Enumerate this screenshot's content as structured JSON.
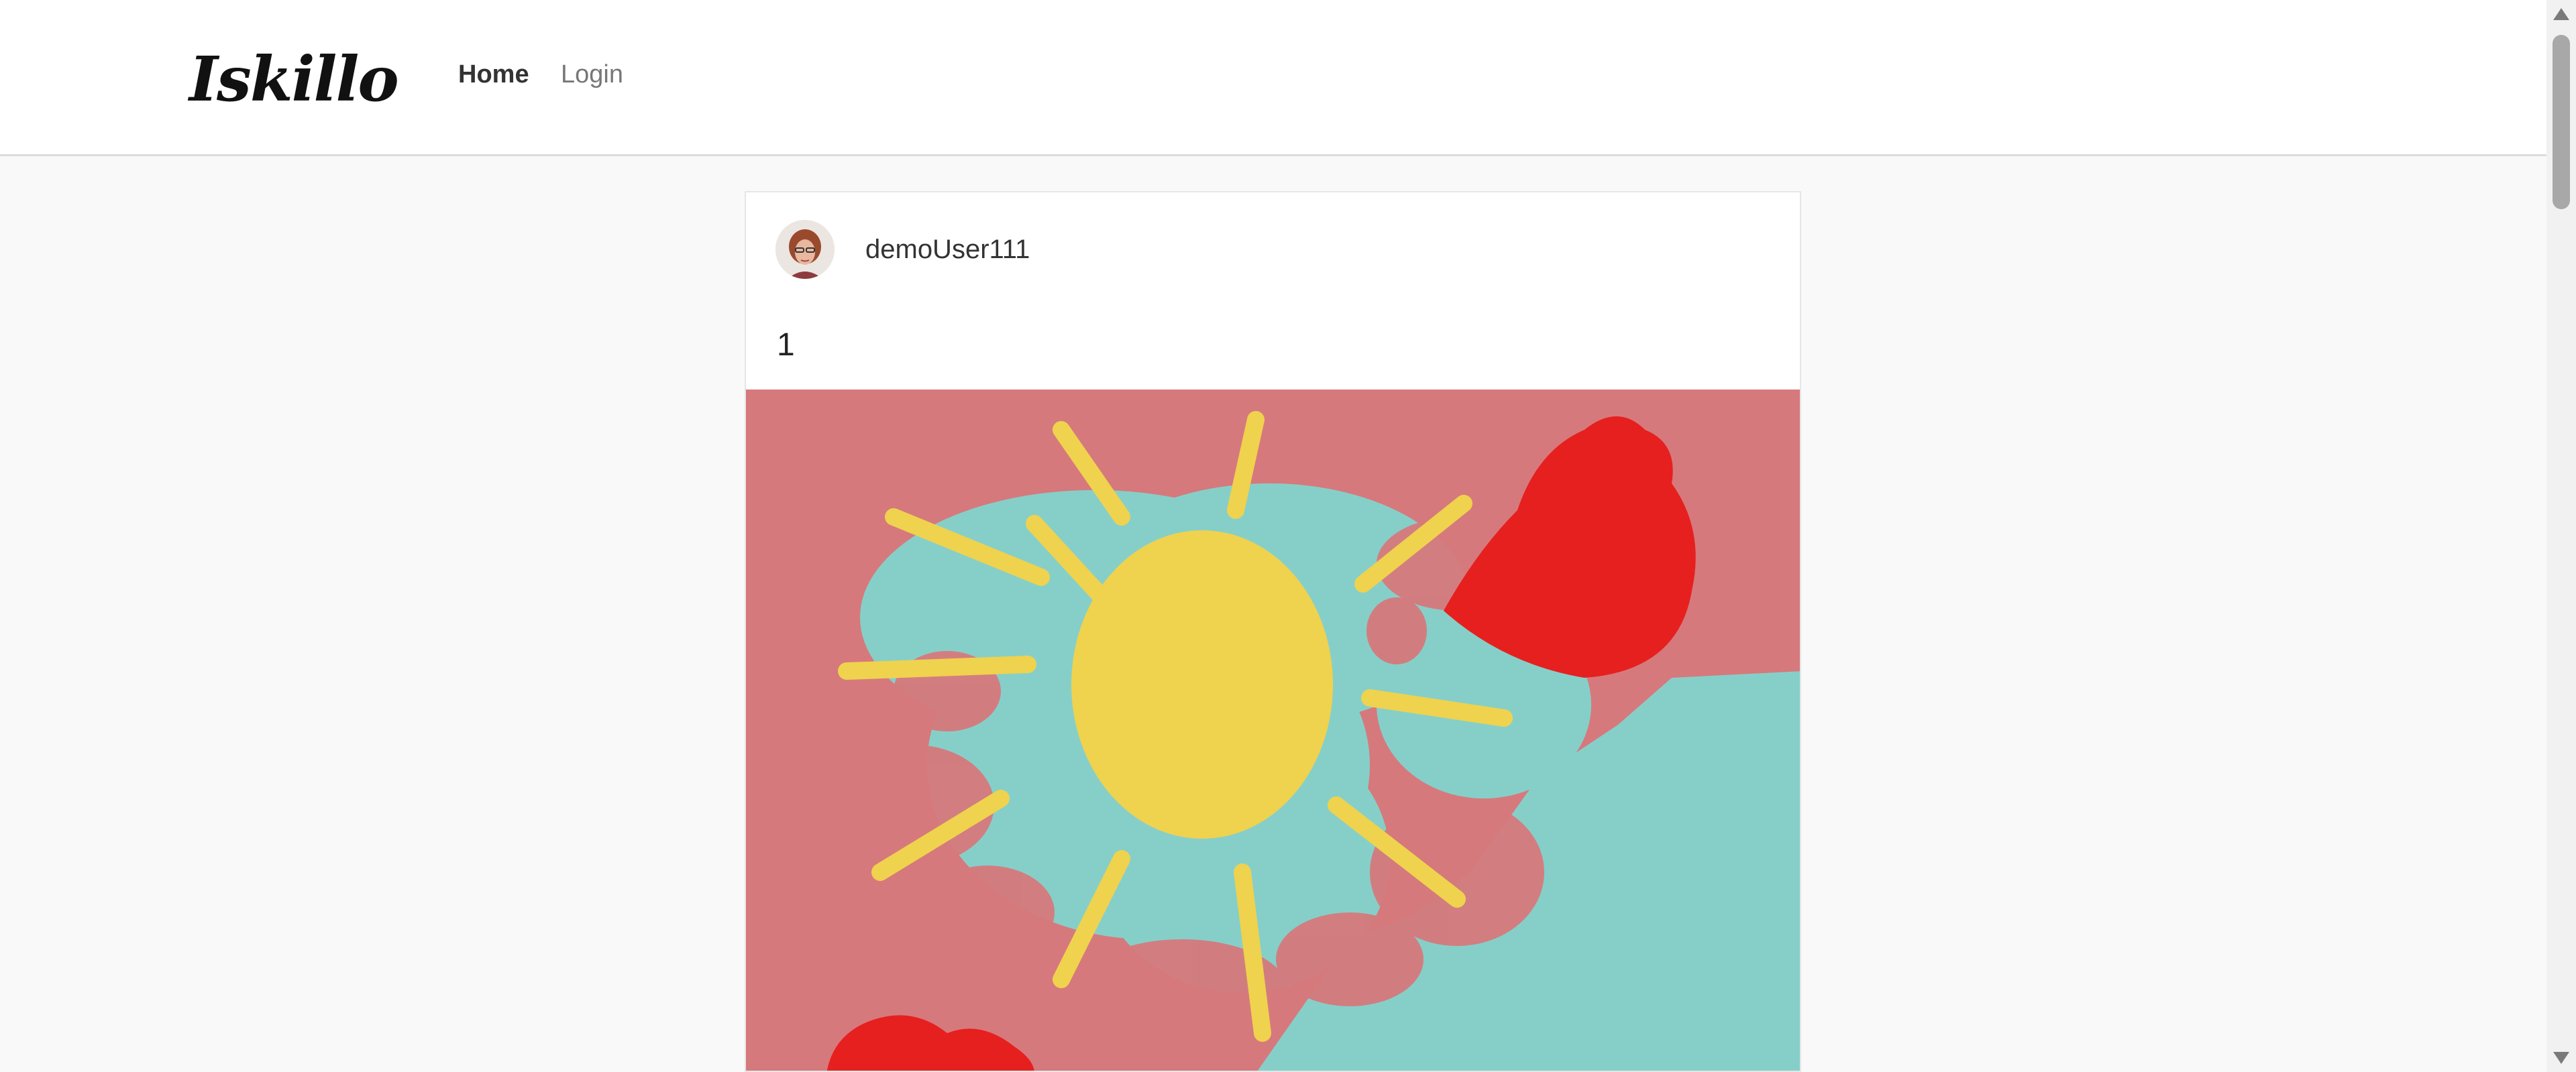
{
  "app": {
    "brand": "Iskillo",
    "brand_icon": "rocket-icon",
    "accent_color": "#2a9fd8"
  },
  "nav": {
    "home_label": "Home",
    "login_label": "Login"
  },
  "post": {
    "username": "demoUser111",
    "caption": "1",
    "image_description_icon": "painting-image"
  },
  "colors": {
    "background": "#f9f9f9",
    "card": "#ffffff",
    "sky": "#86cfc9",
    "pink": "#d6797c",
    "sun": "#efd24e",
    "red": "#e6201f"
  }
}
